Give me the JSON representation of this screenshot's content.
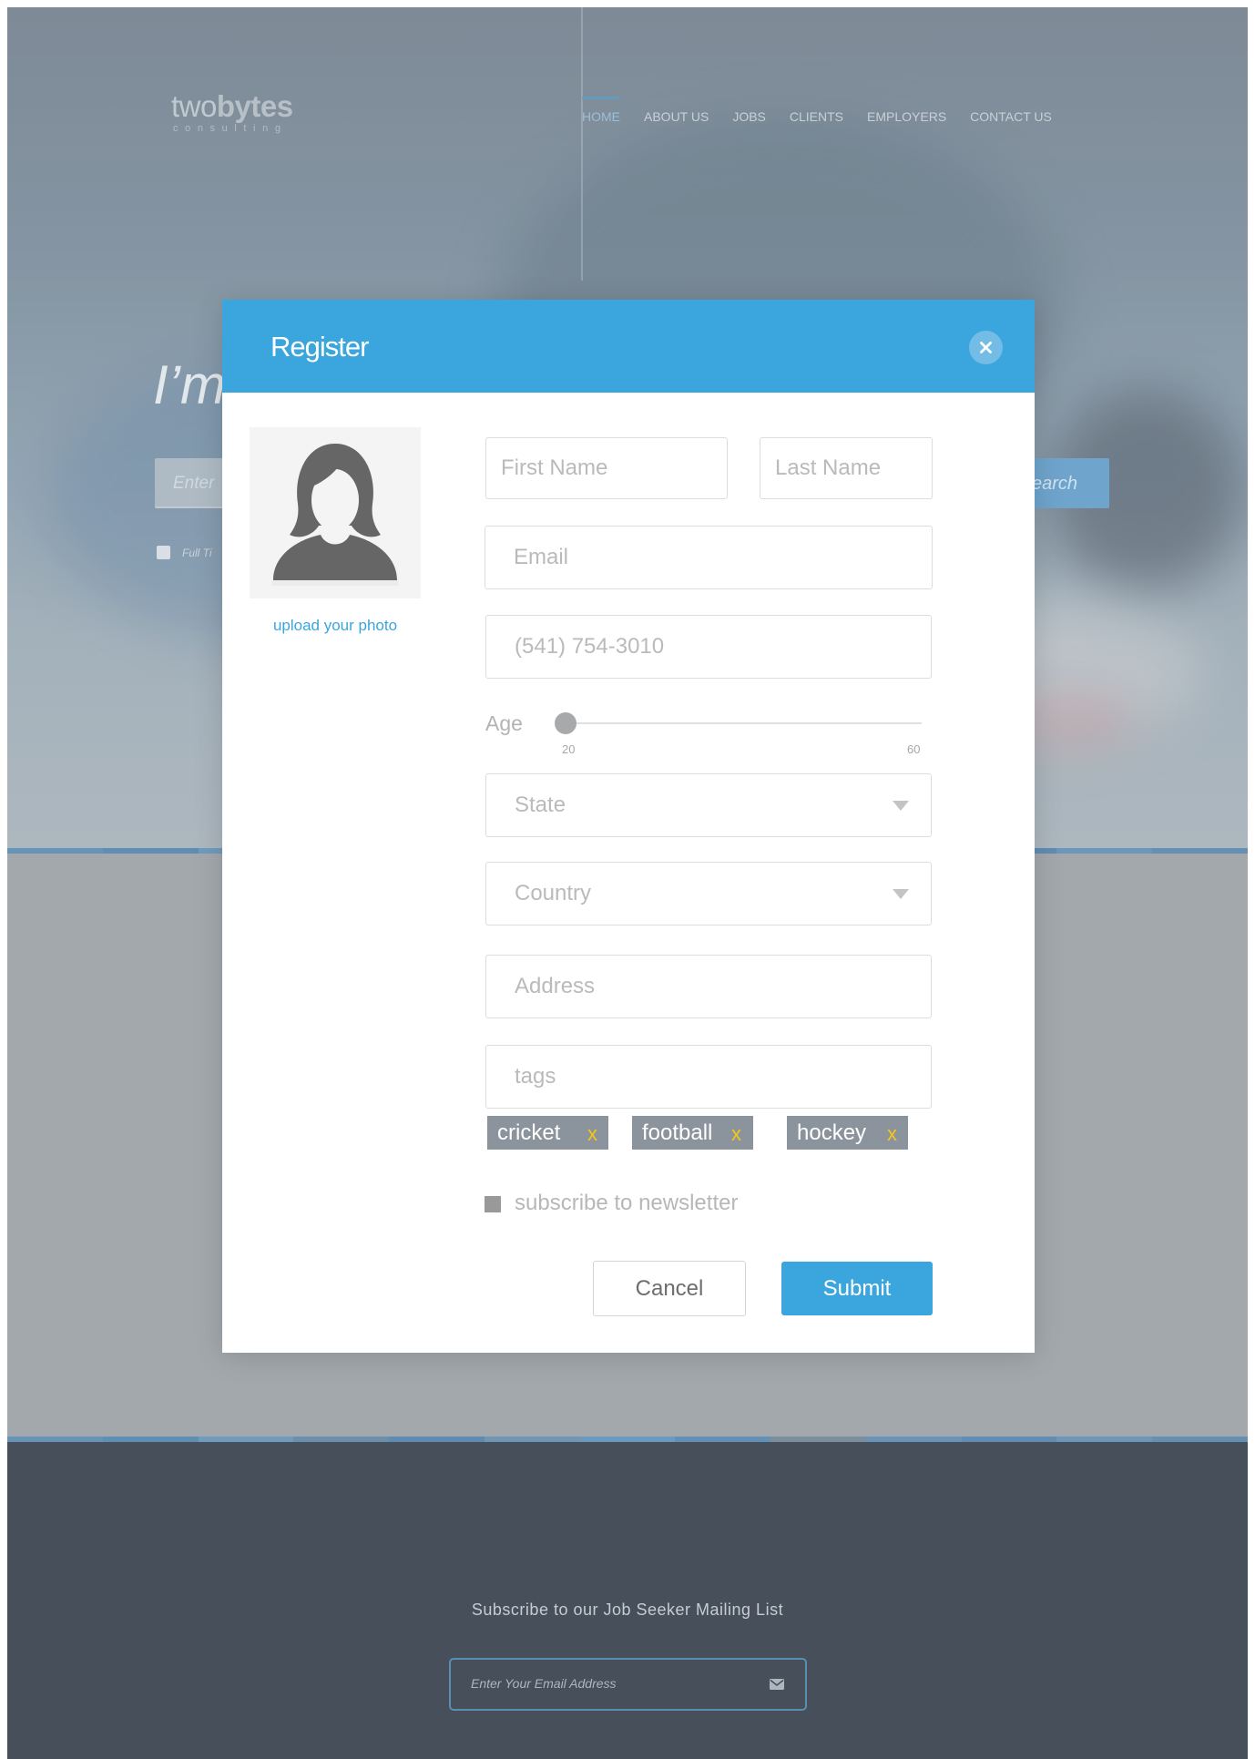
{
  "site": {
    "logo": {
      "light": "two",
      "bold": "bytes",
      "tagline": "consulting"
    },
    "nav": [
      {
        "label": "HOME",
        "active": true
      },
      {
        "label": "ABOUT US",
        "active": false
      },
      {
        "label": "JOBS",
        "active": false
      },
      {
        "label": "CLIENTS",
        "active": false
      },
      {
        "label": "EMPLOYERS",
        "active": false
      },
      {
        "label": "CONTACT US",
        "active": false
      }
    ],
    "hero": {
      "heading_fragment": "I’m",
      "search_placeholder_fragment": "Enter",
      "search_button_fragment": "earch",
      "checkbox_label_fragment": "Full Ti"
    },
    "footer": {
      "subscribe_title": "Subscribe to our Job Seeker Mailing List",
      "email_placeholder": "Enter Your Email Address",
      "email_icon": "envelope-icon"
    }
  },
  "modal": {
    "title": "Register",
    "close_icon": "close-icon",
    "avatar_icon": "female-avatar-icon",
    "upload_label": "upload your photo",
    "fields": {
      "first_name_placeholder": "First Name",
      "last_name_placeholder": "Last Name",
      "email_placeholder": "Email",
      "phone_placeholder": "(541) 754-3010",
      "state_placeholder": "State",
      "country_placeholder": "Country",
      "address_placeholder": "Address",
      "tags_placeholder": "tags"
    },
    "age": {
      "label": "Age",
      "min": "20",
      "max": "60",
      "value": 20
    },
    "tags": [
      {
        "label": "cricket",
        "remove": "x"
      },
      {
        "label": "football",
        "remove": "x"
      },
      {
        "label": "hockey",
        "remove": "x"
      }
    ],
    "newsletter_label": "subscribe to newsletter",
    "newsletter_checked": false,
    "buttons": {
      "cancel": "Cancel",
      "submit": "Submit"
    }
  },
  "colors": {
    "accent": "#3ba6dd",
    "tag_bg": "#8b949d",
    "tag_remove": "#f5c518",
    "footer_bg": "#464f5a",
    "overlay": "#a2a8ac"
  }
}
